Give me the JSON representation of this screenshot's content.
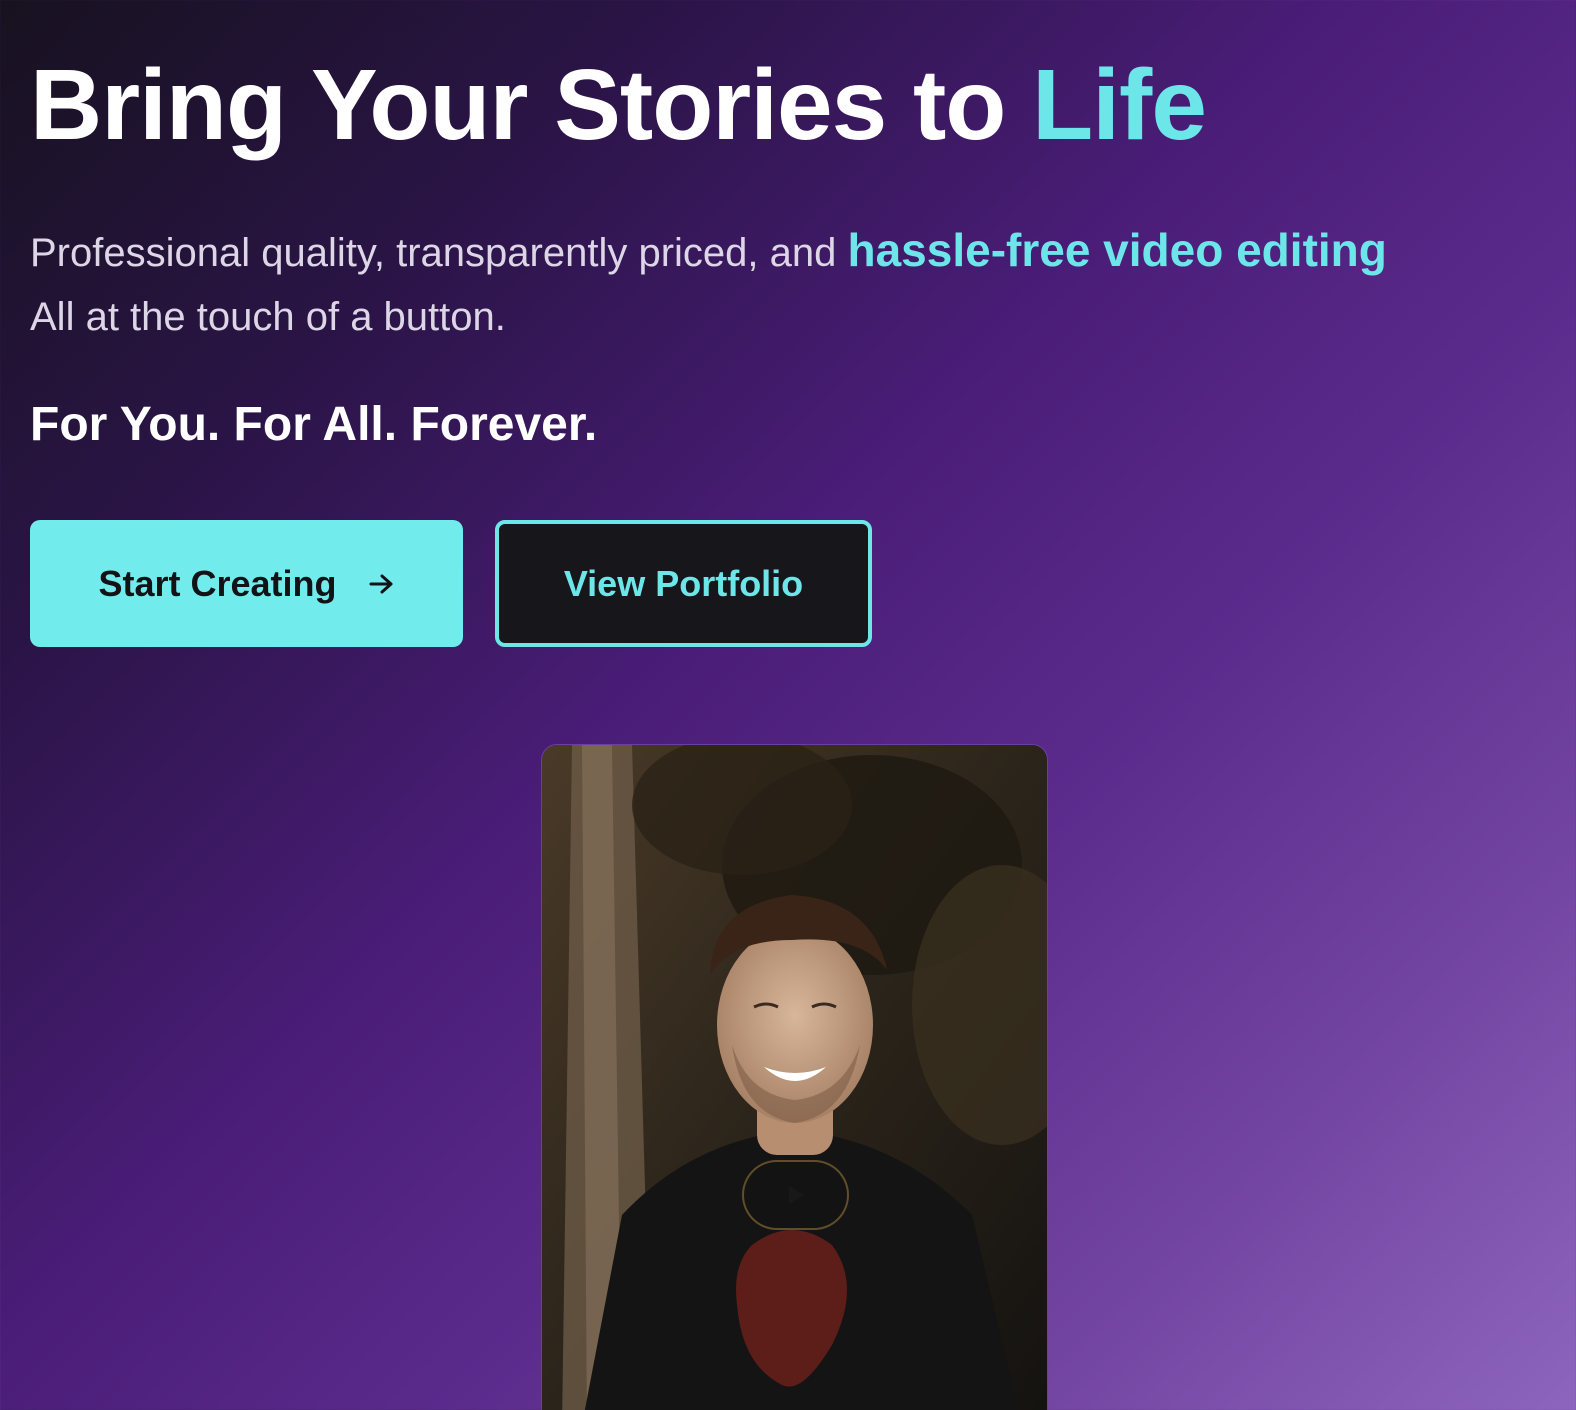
{
  "hero": {
    "headline_main": "Bring Your Stories to ",
    "headline_accent": "Life",
    "subtitle_lead": "Professional quality, transparently priced, and ",
    "subtitle_highlight": "hassle-free video editing",
    "subtitle_tail": "All at the touch of a button.",
    "tagline": "For You. For All. Forever."
  },
  "buttons": {
    "primary_label": "Start Creating",
    "primary_icon": "arrow-right-icon",
    "secondary_label": "View Portfolio"
  },
  "video": {
    "play_icon": "play-icon"
  },
  "colors": {
    "accent": "#6de6ea",
    "primary_button": "#72ebed",
    "secondary_button_bg": "#16161b",
    "background_start": "#17121f",
    "background_end": "#8d65bd"
  }
}
